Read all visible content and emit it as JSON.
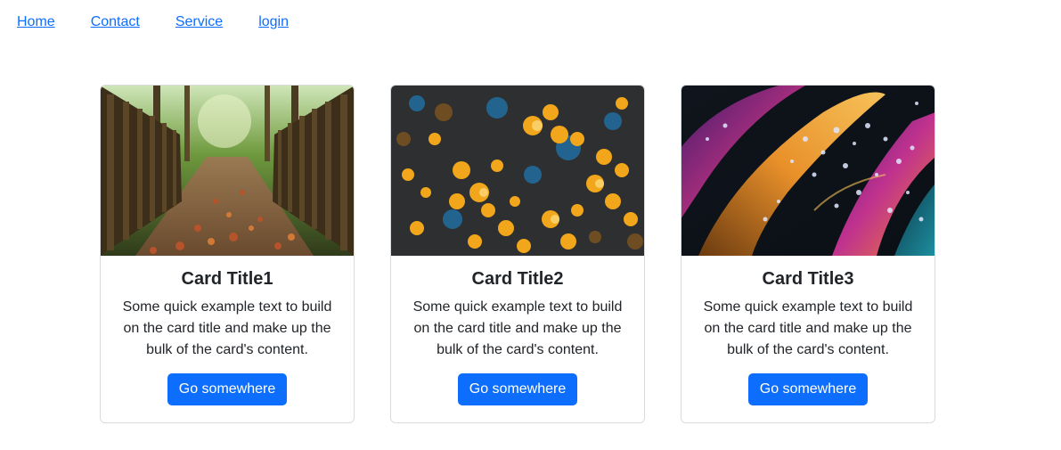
{
  "nav": {
    "items": [
      {
        "label": "Home"
      },
      {
        "label": "Contact"
      },
      {
        "label": "Service"
      },
      {
        "label": "login"
      }
    ]
  },
  "cards": [
    {
      "title": "Card Title1",
      "text": "Some quick example text to build on the card title and make up the bulk of the card's content.",
      "button_label": "Go somewhere",
      "image": "forest-bridge-photo"
    },
    {
      "title": "Card Title2",
      "text": "Some quick example text to build on the card title and make up the bulk of the card's content.",
      "button_label": "Go somewhere",
      "image": "bokeh-lights-photo"
    },
    {
      "title": "Card Title3",
      "text": "Some quick example text to build on the card title and make up the bulk of the card's content.",
      "button_label": "Go somewhere",
      "image": "colorful-feathers-droplets-photo"
    }
  ],
  "colors": {
    "link": "#0d6efd",
    "button": "#0d6efd",
    "text": "#212529",
    "border": "#d9dcdf"
  }
}
